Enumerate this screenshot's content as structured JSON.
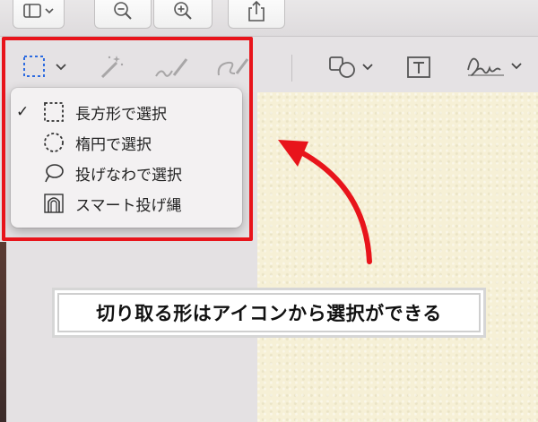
{
  "menu": {
    "items": [
      {
        "label": "長方形で選択",
        "icon": "rectangle-select-icon",
        "checked": true
      },
      {
        "label": "楕円で選択",
        "icon": "ellipse-select-icon",
        "checked": false
      },
      {
        "label": "投げなわで選択",
        "icon": "lasso-select-icon",
        "checked": false
      },
      {
        "label": "スマート投げ縄",
        "icon": "smart-lasso-icon",
        "checked": false
      }
    ],
    "check_mark": "✓"
  },
  "caption": "切り取る形はアイコンから選択ができる",
  "colors": {
    "highlight": "#e8141b",
    "selection_icon": "#2d6be0",
    "paper": "#f6f0d6"
  }
}
